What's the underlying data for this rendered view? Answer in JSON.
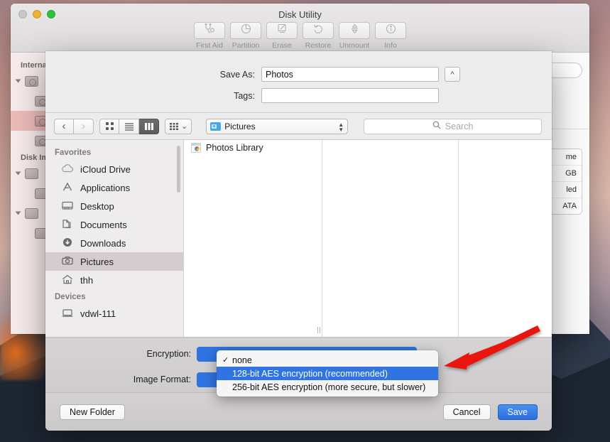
{
  "app_window": {
    "title": "Disk Utility",
    "traffic_lights": [
      "close",
      "minimize",
      "maximize"
    ],
    "toolbar": [
      {
        "label": "First Aid",
        "icon": "stethoscope-icon"
      },
      {
        "label": "Partition",
        "icon": "pie-chart-icon"
      },
      {
        "label": "Erase",
        "icon": "erase-icon"
      },
      {
        "label": "Restore",
        "icon": "undo-arrow-icon"
      },
      {
        "label": "Unmount",
        "icon": "eject-arrows-icon"
      },
      {
        "label": "Info",
        "icon": "info-circle-icon"
      }
    ],
    "sidebar": {
      "groups": [
        {
          "title": "Internal",
          "items": [
            {
              "label": "",
              "icon": "hard-disk-icon",
              "level": 0,
              "expanded": true,
              "selected": false
            },
            {
              "label": "",
              "icon": "hard-disk-icon",
              "level": 1,
              "selected": false
            },
            {
              "label": "",
              "icon": "hard-disk-icon",
              "level": 1,
              "selected": true
            },
            {
              "label": "",
              "icon": "hard-disk-icon",
              "level": 1,
              "selected": false
            }
          ]
        },
        {
          "title": "Disk Ima",
          "items": [
            {
              "label": "",
              "icon": "disk-image-icon",
              "level": 0,
              "expanded": true,
              "selected": false
            },
            {
              "label": "",
              "icon": "disk-image-icon",
              "level": 1,
              "selected": false
            },
            {
              "label": "",
              "icon": "disk-image-icon",
              "level": 0,
              "expanded": true,
              "selected": false
            },
            {
              "label": "",
              "icon": "disk-image-icon",
              "level": 1,
              "selected": false
            }
          ]
        }
      ]
    },
    "info_panel_rows": [
      "me",
      "GB",
      "led",
      "ATA"
    ]
  },
  "save_sheet": {
    "save_as": {
      "label": "Save As:",
      "value": "Photos",
      "placeholder": ""
    },
    "tags": {
      "label": "Tags:",
      "value": "",
      "placeholder": ""
    },
    "disclosure_glyph": "^",
    "nav": {
      "back_glyph": "‹",
      "forward_glyph": "›",
      "view_modes": [
        {
          "name": "icon-view",
          "selected": false
        },
        {
          "name": "list-view",
          "selected": false
        },
        {
          "name": "column-view",
          "selected": true
        }
      ],
      "arrange_glyph": "⌄",
      "path_popup": {
        "label": "Pictures",
        "icon": "pictures-folder-icon"
      },
      "search": {
        "placeholder": "Search",
        "value": "",
        "icon": "search-icon"
      }
    },
    "favorites": {
      "group_label": "Favorites",
      "items": [
        {
          "label": "iCloud Drive",
          "icon": "icloud-icon",
          "selected": false
        },
        {
          "label": "Applications",
          "icon": "applications-icon",
          "selected": false
        },
        {
          "label": "Desktop",
          "icon": "desktop-icon",
          "selected": false
        },
        {
          "label": "Documents",
          "icon": "documents-icon",
          "selected": false
        },
        {
          "label": "Downloads",
          "icon": "downloads-icon",
          "selected": false
        },
        {
          "label": "Pictures",
          "icon": "pictures-icon",
          "selected": true
        },
        {
          "label": "thh",
          "icon": "home-icon",
          "selected": false
        }
      ]
    },
    "devices": {
      "group_label": "Devices",
      "items": [
        {
          "label": "vdwl-111",
          "icon": "computer-icon",
          "selected": false
        }
      ]
    },
    "file_columns": {
      "column1": [
        {
          "label": "Photos Library",
          "icon": "photos-library-icon"
        }
      ],
      "column2": [],
      "column3": []
    },
    "options": {
      "encryption_label": "Encryption:",
      "image_format_label": "Image Format:"
    },
    "footer": {
      "new_folder_label": "New Folder",
      "cancel_label": "Cancel",
      "save_label": "Save"
    }
  },
  "encryption_menu": {
    "items": [
      {
        "label": "none",
        "checked": true,
        "highlighted": false
      },
      {
        "label": "128-bit AES encryption (recommended)",
        "checked": false,
        "highlighted": true
      },
      {
        "label": "256-bit AES encryption (more secure, but slower)",
        "checked": false,
        "highlighted": false
      }
    ],
    "check_glyph": "✓"
  },
  "annotation": {
    "arrow_color": "#e8170f",
    "points_to": "128-bit AES encryption (recommended)"
  },
  "colors": {
    "accent_blue": "#2f74e0",
    "sheet_bg": "#ececec",
    "window_bg": "#f3f1f2",
    "selection_pink": "#e29690"
  }
}
